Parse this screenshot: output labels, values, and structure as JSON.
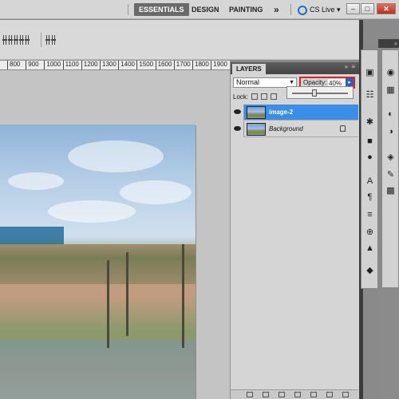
{
  "workspace": {
    "essentials": "ESSENTIALS",
    "design": "DESIGN",
    "painting": "PAINTING",
    "more": "»",
    "cslive": "CS Live ▾"
  },
  "window": {
    "minimize": "–",
    "maximize": "□",
    "close": "✕"
  },
  "ruler": {
    "ticks": [
      "800",
      "900",
      "1000",
      "1100",
      "1200",
      "1300",
      "1400",
      "1500",
      "1600",
      "1700",
      "1800",
      "1900"
    ]
  },
  "layers_panel": {
    "tab": "LAYERS",
    "menu": "» ≡",
    "blend_mode": "Normal",
    "blend_arrow": "▼",
    "opacity_label": "Opacity:",
    "opacity_value": "40%",
    "opacity_button": "▸",
    "lock_label": "Lock:",
    "slider_level_percent": 40,
    "layers": [
      {
        "name": "image-2",
        "selected": true
      },
      {
        "name": "Background",
        "selected": false,
        "locked": true
      }
    ]
  },
  "colors": {
    "selected_layer": "#3a8ee8",
    "highlight_box": "#e0202a",
    "active_workspace": "#6a6a6a"
  },
  "icons": [
    "cs-live-icon",
    "eye-icon",
    "lock-icon",
    "mini-bridge-icon",
    "swatches-icon",
    "adjustments-icon",
    "character-icon",
    "paragraph-icon",
    "layers-icon",
    "history-icon",
    "navigator-icon",
    "info-icon",
    "brushes-icon",
    "clone-source-icon"
  ]
}
